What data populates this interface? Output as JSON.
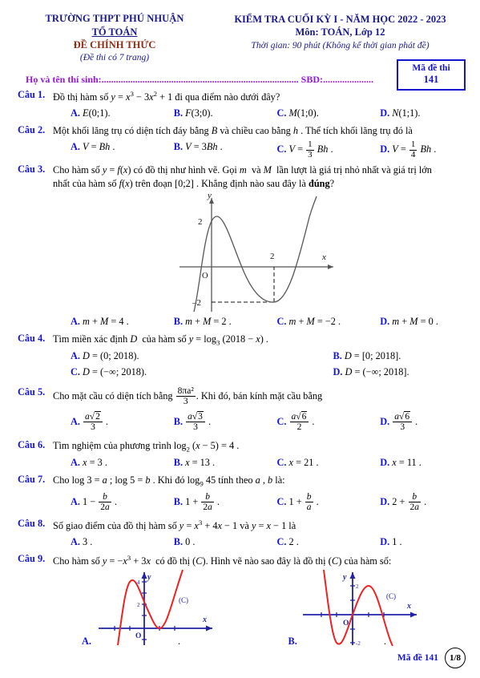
{
  "header": {
    "school": "TRƯỜNG THPT PHÚ NHUẬN",
    "department": "TỔ TOÁN",
    "official": "ĐỀ CHÍNH THỨC",
    "pages_note": "(Đề thi có 7 trang)",
    "exam_title": "KIỂM TRA CUỐI KỲ I - NĂM HỌC 2022 - 2023",
    "subject": "Môn: TOÁN, Lớp 12",
    "duration": "Thời gian: 90 phút (Không kể thời gian phát đề)",
    "code_label": "Mã đề thi",
    "code_value": "141",
    "candidate_line": "Họ và tên thí sinh:.................................................................................. SBD:....................."
  },
  "colors": {
    "navy": "#17188c",
    "blue": "#1414d2",
    "maroon": "#8f2a13",
    "violet": "#9317d6",
    "curve_red": "#ee2222",
    "axis_blue": "#2222aa"
  },
  "questions": [
    {
      "label": "Câu 1.",
      "stem_pre": "Đồ thị hàm số ",
      "stem_math": "y = x³ − 3x² + 1",
      "stem_post": " đi qua điểm nào dưới đây?",
      "options": [
        {
          "letter": "A.",
          "text": "E(0;1)."
        },
        {
          "letter": "B.",
          "text": "F(3;0)."
        },
        {
          "letter": "C.",
          "text": "M(1;0)."
        },
        {
          "letter": "D.",
          "text": "N(1;1)."
        }
      ]
    },
    {
      "label": "Câu 2.",
      "stem": "Một khối lăng trụ có diện tích đáy bằng B và chiều cao bằng h . Thể tích khối lăng trụ đó là",
      "options": [
        {
          "letter": "A.",
          "text": "V = Bh ."
        },
        {
          "letter": "B.",
          "text": "V = 3Bh ."
        },
        {
          "letter": "C.",
          "text": "V = 1/3 Bh ."
        },
        {
          "letter": "D.",
          "text": "V = 1/4 Bh ."
        }
      ]
    },
    {
      "label": "Câu 3.",
      "stem_line1": "Cho hàm số y = f(x) có đồ thị như hình vẽ. Gọi m  và M  lần lượt là giá trị nhỏ nhất và giá trị lớn",
      "stem_line2": "nhất của hàm số f(x) trên đoạn [0;2] . Khẳng định nào sau đây là đúng?",
      "options": [
        {
          "letter": "A.",
          "text": "m + M = 4 ."
        },
        {
          "letter": "B.",
          "text": "m + M = 2 ."
        },
        {
          "letter": "C.",
          "text": "m + M = −2 ."
        },
        {
          "letter": "D.",
          "text": "m + M = 0 ."
        }
      ]
    },
    {
      "label": "Câu 4.",
      "stem": "Tìm miền xác định D  của hàm số y = log₃ (2018 − x) .",
      "options": [
        {
          "letter": "A.",
          "text": "D = (0; 2018)."
        },
        {
          "letter": "B.",
          "text": "D = [0; 2018]."
        },
        {
          "letter": "C.",
          "text": "D = (−∞; 2018)."
        },
        {
          "letter": "D.",
          "text": "D = (−∞; 2018]."
        }
      ]
    },
    {
      "label": "Câu 5.",
      "stem_pre": "Cho mặt cầu có diện tích bằng ",
      "stem_frac_num": "8πa²",
      "stem_frac_den": "3",
      "stem_post": ". Khi đó, bán kính mặt cầu bằng",
      "options": [
        {
          "letter": "A.",
          "num": "a√2",
          "den": "3"
        },
        {
          "letter": "B.",
          "num": "a√3",
          "den": "3"
        },
        {
          "letter": "C.",
          "num": "a√6",
          "den": "2"
        },
        {
          "letter": "D.",
          "num": "a√6",
          "den": "3"
        }
      ]
    },
    {
      "label": "Câu 6.",
      "stem": "Tìm nghiệm của phương trình log₂ (x − 5) = 4 .",
      "options": [
        {
          "letter": "A.",
          "text": "x = 3 ."
        },
        {
          "letter": "B.",
          "text": "x = 13 ."
        },
        {
          "letter": "C.",
          "text": "x = 21 ."
        },
        {
          "letter": "D.",
          "text": "x = 11 ."
        }
      ]
    },
    {
      "label": "Câu 7.",
      "stem": "Cho log 3 = a ; log 5 = b . Khi đó log₉ 45 tính theo a , b là:",
      "options": [
        {
          "letter": "A.",
          "lead": "1 −",
          "num": "b",
          "den": "2a"
        },
        {
          "letter": "B.",
          "lead": "1 +",
          "num": "b",
          "den": "2a"
        },
        {
          "letter": "C.",
          "lead": "1 +",
          "num": "b",
          "den": "a"
        },
        {
          "letter": "D.",
          "lead": "2 +",
          "num": "b",
          "den": "2a"
        }
      ]
    },
    {
      "label": "Câu 8.",
      "stem": "Số giao điểm của đồ thị hàm số y = x³ + 4x − 1 và y = x − 1 là",
      "options": [
        {
          "letter": "A.",
          "text": "3 ."
        },
        {
          "letter": "B.",
          "text": "0 ."
        },
        {
          "letter": "C.",
          "text": "2 ."
        },
        {
          "letter": "D.",
          "text": "1 ."
        }
      ]
    },
    {
      "label": "Câu 9.",
      "stem": "Cho hàm số y = −x³ + 3x  có đồ thị (C). Hình vẽ nào sao đây là đồ thị (C) của hàm số:",
      "options": [
        {
          "letter": "A.",
          "text": "."
        },
        {
          "letter": "B.",
          "text": "."
        }
      ]
    }
  ],
  "figure_c3": {
    "axis_x_label": "x",
    "axis_y_label": "y",
    "origin_label": "O",
    "tick_y_pos": "2",
    "tick_y_neg": "−2",
    "tick_x": "2",
    "description": "cubic with local max (0,2) and local min (2,-2)"
  },
  "figure_q9a": {
    "axis_x_label": "x",
    "axis_y_label": "y",
    "origin_label": "O",
    "curve_label": "(C)",
    "tick_4": "4",
    "tick_2": "2",
    "description": "increasing cubic, local max (-1,4), local min (1,0)"
  },
  "figure_q9b": {
    "axis_x_label": "x",
    "axis_y_label": "y",
    "origin_label": "O",
    "curve_label": "(C)",
    "tick_2": "2",
    "tick_neg2": "-2",
    "description": "decreasing cubic, local min (-1,-2), local max (1,2)"
  },
  "footer": {
    "code_text": "Mã đề 141",
    "page": "1/8"
  }
}
